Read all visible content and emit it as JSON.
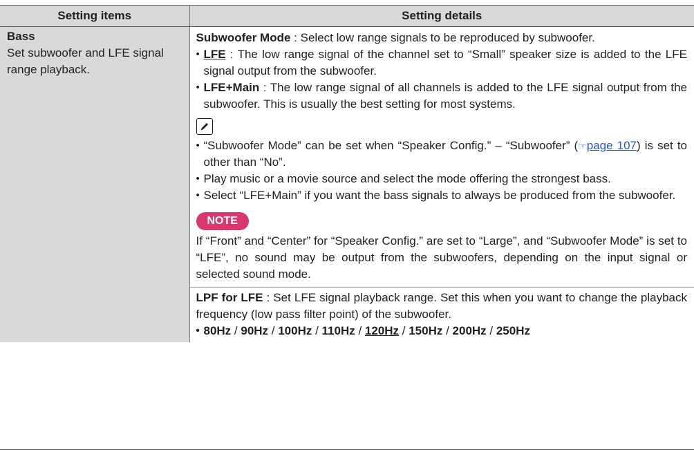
{
  "table": {
    "header_items": "Setting items",
    "header_details": "Setting details"
  },
  "bass": {
    "title": "Bass",
    "description": "Set subwoofer and LFE signal range playback."
  },
  "subwoofer_mode": {
    "name": "Subwoofer Mode",
    "desc": " : Select low range signals to be reproduced by subwoofer.",
    "options": [
      {
        "label": "LFE",
        "text": " : The low range signal of the channel set to “Small” speaker size is added to the LFE signal output from the subwoofer."
      },
      {
        "label": "LFE+Main",
        "text": " : The low range signal of all channels is added to the LFE signal output from the subwoofer. This is usually the best setting for most systems."
      }
    ],
    "notes": [
      {
        "pre": "“Subwoofer Mode” can be set when “Speaker Config.” – “Subwoofer” (",
        "link": "page 107",
        "post": ") is set to other than “No”."
      },
      {
        "text": "Play music or a movie source and select the mode offering the strongest bass."
      },
      {
        "text": "Select “LFE+Main” if you want the bass signals to always be produced from the subwoofer."
      }
    ],
    "note_label": "NOTE",
    "note_text": "If “Front” and “Center” for “Speaker Config.” are set to “Large”, and “Subwoofer Mode” is set to “LFE”, no sound may be output from the subwoofers, depending on the input signal or selected sound mode."
  },
  "lpf": {
    "name": "LPF for LFE",
    "desc": " : Set LFE signal playback range. Set this when you want to change the playback frequency (low pass filter point) of the subwoofer.",
    "values": [
      "80Hz",
      "90Hz",
      "100Hz",
      "110Hz",
      "120Hz",
      "150Hz",
      "200Hz",
      "250Hz"
    ],
    "separator": " / "
  },
  "colors": {
    "header_bg": "#d9d9d9",
    "note_badge": "#d8386d",
    "link": "#2a57c5"
  }
}
